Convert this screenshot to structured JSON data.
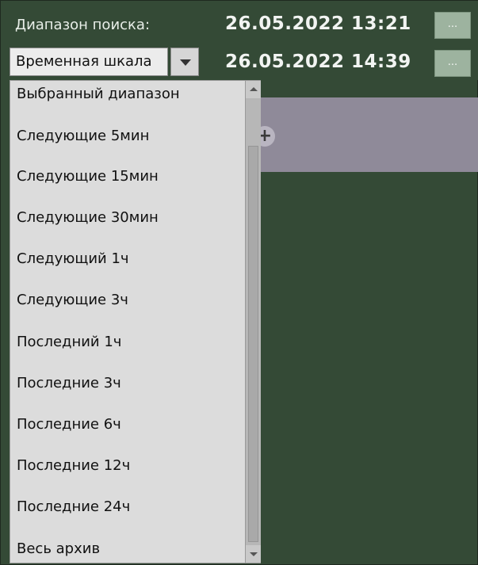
{
  "search": {
    "label": "Диапазон поиска:",
    "start_datetime": "26.05.2022  13:21",
    "end_datetime": "26.05.2022  14:39",
    "more_label": "..."
  },
  "mode_select": {
    "value": "Временная шкала",
    "options": [
      "Выбранный диапазон",
      "Следующие 5мин",
      "Следующие 15мин",
      "Следующие 30мин",
      "Следующий 1ч",
      "Следующие 3ч",
      "Последний 1ч",
      "Последние 3ч",
      "Последние 6ч",
      "Последние 12ч",
      "Последние 24ч",
      "Весь архив"
    ]
  },
  "icons": {
    "dropdown": "chevron-down-icon",
    "add": "plus-icon",
    "scroll_up": "scroll-up-icon",
    "scroll_down": "scroll-down-icon"
  },
  "colors": {
    "background": "#344a36",
    "timeline_band": "#8f8a99",
    "button": "#9db39f",
    "dropdown": "#dcdcdc"
  }
}
